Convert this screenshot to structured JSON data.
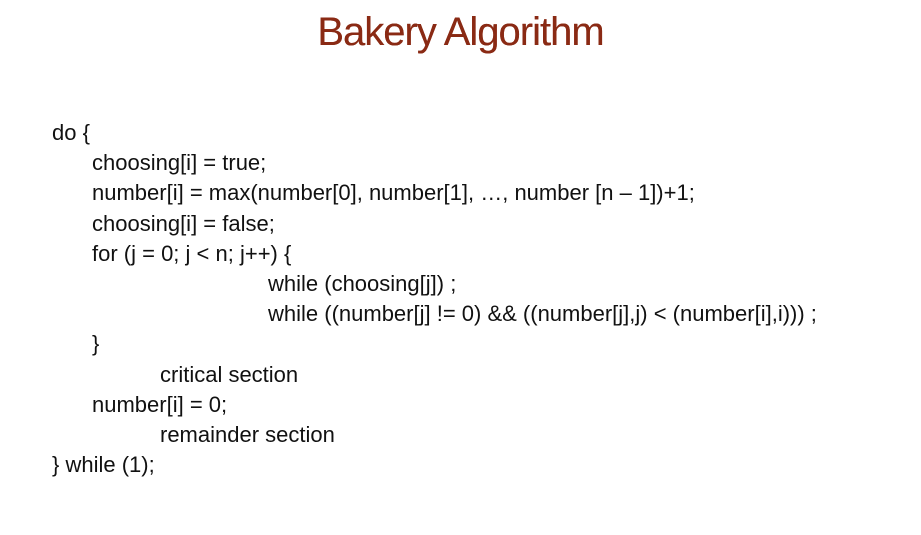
{
  "title": "Bakery Algorithm",
  "code_lines": [
    {
      "text": "do {"
    },
    {
      "text": "choosing[i] = true;"
    },
    {
      "text": "number[i] = max(number[0], number[1], …, number [n – 1])+1;"
    },
    {
      "text": "choosing[i] = false;"
    },
    {
      "text": "for (j = 0; j < n; j++) {"
    },
    {
      "text": "while (choosing[j]) ;"
    },
    {
      "text": "while ((number[j] != 0) && ((number[j],j) < (number[i],i))) ;"
    },
    {
      "text": "}"
    },
    {
      "text": "critical section"
    },
    {
      "text": "number[i] = 0;"
    },
    {
      "text": "remainder section"
    },
    {
      "text": "} while (1);"
    }
  ]
}
